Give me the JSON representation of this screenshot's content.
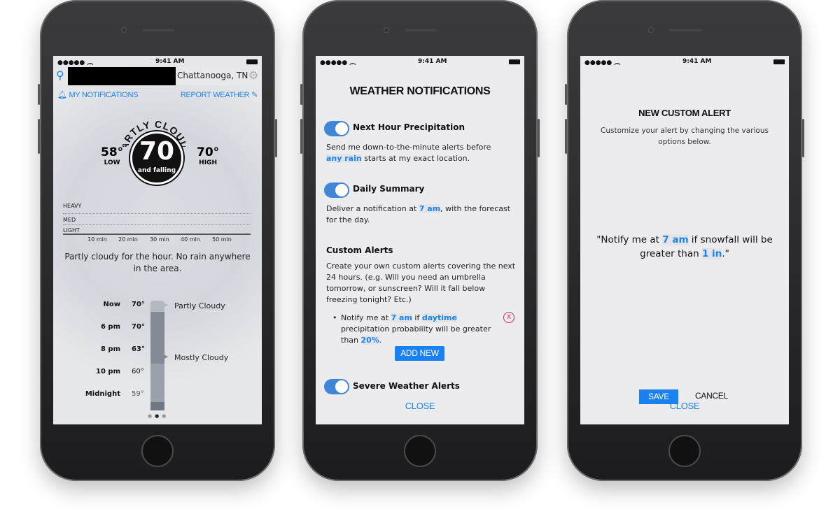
{
  "status": {
    "time": "9:41 AM"
  },
  "screen1": {
    "location": "Chattanooga, TN",
    "my_notifications": "MY NOTIFICATIONS",
    "report_weather": "REPORT WEATHER",
    "condition": "PARTLY CLOUDY",
    "current_temp": "70",
    "trend": "and falling",
    "low": "58°",
    "low_label": "LOW",
    "high": "70°",
    "high_label": "HIGH",
    "precip_levels": [
      "HEAVY",
      "MED",
      "LIGHT"
    ],
    "time_ticks": [
      "10 min",
      "20 min",
      "30 min",
      "40 min",
      "50 min"
    ],
    "summary": "Partly cloudy for the hour. No rain anywhere in the area.",
    "forecast": [
      {
        "time": "Now",
        "temp": "70°"
      },
      {
        "time": "6 pm",
        "temp": "70°"
      },
      {
        "time": "8 pm",
        "temp": "63°"
      },
      {
        "time": "10 pm",
        "temp": "60°"
      },
      {
        "time": "Midnight",
        "temp": "59°"
      }
    ],
    "forecast_conditions": [
      "Partly Cloudy",
      "Mostly Cloudy"
    ],
    "page_index": 2,
    "page_count": 3
  },
  "screen2": {
    "title": "WEATHER NOTIFICATIONS",
    "next_hour": {
      "label": "Next Hour Precipitation",
      "on": true,
      "text_a": "Send me down-to-the-minute alerts before ",
      "link": "any rain",
      "text_b": " starts at my exact location."
    },
    "daily": {
      "label": "Daily Summary",
      "on": true,
      "text_a": "Deliver a notification at ",
      "link": "7 am",
      "text_b": ", with the forecast for the day."
    },
    "custom": {
      "heading": "Custom Alerts",
      "text": "Create your own custom alerts covering the next 24 hours. (e.g. Will you need an umbrella tomorrow, or sunscreen? Will it fall below freezing tonight? Etc.)",
      "alert": {
        "a": "Notify me at ",
        "time": "7 am",
        "b": " if ",
        "period": "daytime",
        "c": " precipitation probability will be greater than ",
        "value": "20%",
        "d": "."
      },
      "remove": "X",
      "add_new": "ADD NEW"
    },
    "severe": {
      "label": "Severe Weather Alerts",
      "on": true
    },
    "close": "CLOSE"
  },
  "screen3": {
    "title": "NEW CUSTOM ALERT",
    "subtitle": "Customize your alert by changing the various options below.",
    "sentence": {
      "a": "\"Notify me at ",
      "time": "7 am",
      "b": " if snowfall will be greater than ",
      "amount": "1 in",
      "c": ".\""
    },
    "save": "SAVE",
    "cancel": "CANCEL",
    "close": "CLOSE"
  },
  "colors": {
    "accent": "#1a82f0",
    "toggle": "#3f86d6",
    "remove": "#e0245e"
  }
}
